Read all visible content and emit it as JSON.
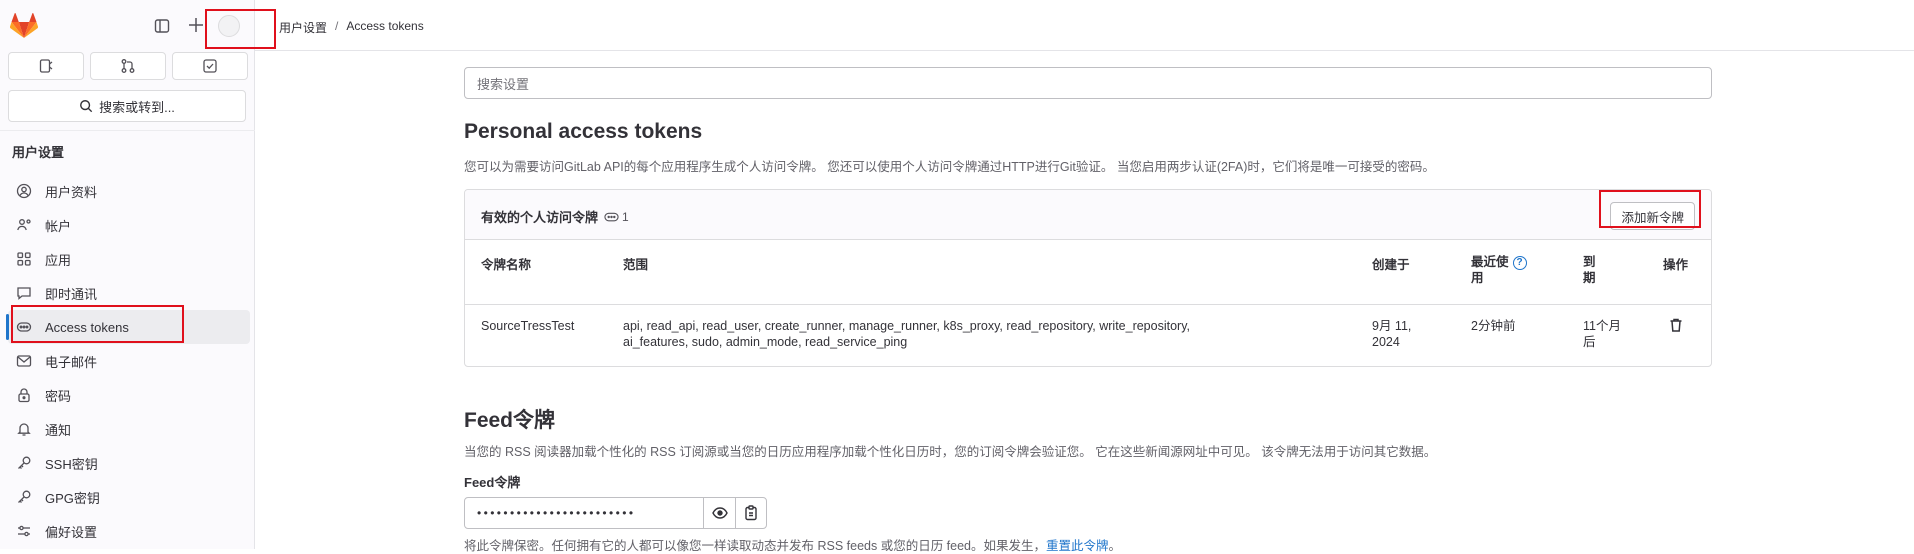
{
  "breadcrumb": {
    "parent": "用户设置",
    "separator": "/",
    "current": "Access tokens"
  },
  "sidebar": {
    "search_label": "搜索或转到...",
    "heading": "用户设置",
    "items": [
      {
        "label": "用户资料",
        "icon": "profile-icon"
      },
      {
        "label": "帐户",
        "icon": "account-icon"
      },
      {
        "label": "应用",
        "icon": "applications-icon"
      },
      {
        "label": "即时通讯",
        "icon": "chat-icon"
      },
      {
        "label": "Access tokens",
        "icon": "token-icon",
        "active": true
      },
      {
        "label": "电子邮件",
        "icon": "mail-icon"
      },
      {
        "label": "密码",
        "icon": "lock-icon"
      },
      {
        "label": "通知",
        "icon": "bell-icon"
      },
      {
        "label": "SSH密钥",
        "icon": "key-icon"
      },
      {
        "label": "GPG密钥",
        "icon": "key-icon"
      },
      {
        "label": "偏好设置",
        "icon": "preferences-icon"
      }
    ]
  },
  "search": {
    "placeholder": "搜索设置"
  },
  "pat": {
    "title": "Personal access tokens",
    "description": "您可以为需要访问GitLab API的每个应用程序生成个人访问令牌。 您还可以使用个人访问令牌通过HTTP进行Git验证。 当您启用两步认证(2FA)时，它们将是唯一可接受的密码。",
    "card_title": "有效的个人访问令牌",
    "count": "1",
    "add_button": "添加新令牌",
    "columns": {
      "name": "令牌名称",
      "scope": "范围",
      "created": "创建于",
      "last_used_1": "最近使",
      "last_used_2": "用",
      "expires_1": "到",
      "expires_2": "期",
      "actions": "操作"
    },
    "rows": [
      {
        "name": "SourceTressTest",
        "scopes_line1": "api, read_api, read_user, create_runner, manage_runner, k8s_proxy, read_repository, write_repository,",
        "scopes_line2": "ai_features, sudo, admin_mode, read_service_ping",
        "created_1": "9月 11,",
        "created_2": "2024",
        "last_used": "2分钟前",
        "expires_1": "11个月",
        "expires_2": "后"
      }
    ]
  },
  "feed": {
    "title": "Feed令牌",
    "description": "当您的 RSS 阅读器加载个性化的 RSS 订阅源或当您的日历应用程序加载个性化日历时，您的订阅令牌会验证您。 它在这些新闻源网址中可见。 该令牌无法用于访问其它数据。",
    "label": "Feed令牌",
    "value": "••••••••••••••••••••••••",
    "help_text": "将此令牌保密。任何拥有它的人都可以像您一样读取动态并发布 RSS feeds 或您的日历 feed。如果发生，",
    "reset_link": "重置此令牌",
    "help_end": "。"
  }
}
